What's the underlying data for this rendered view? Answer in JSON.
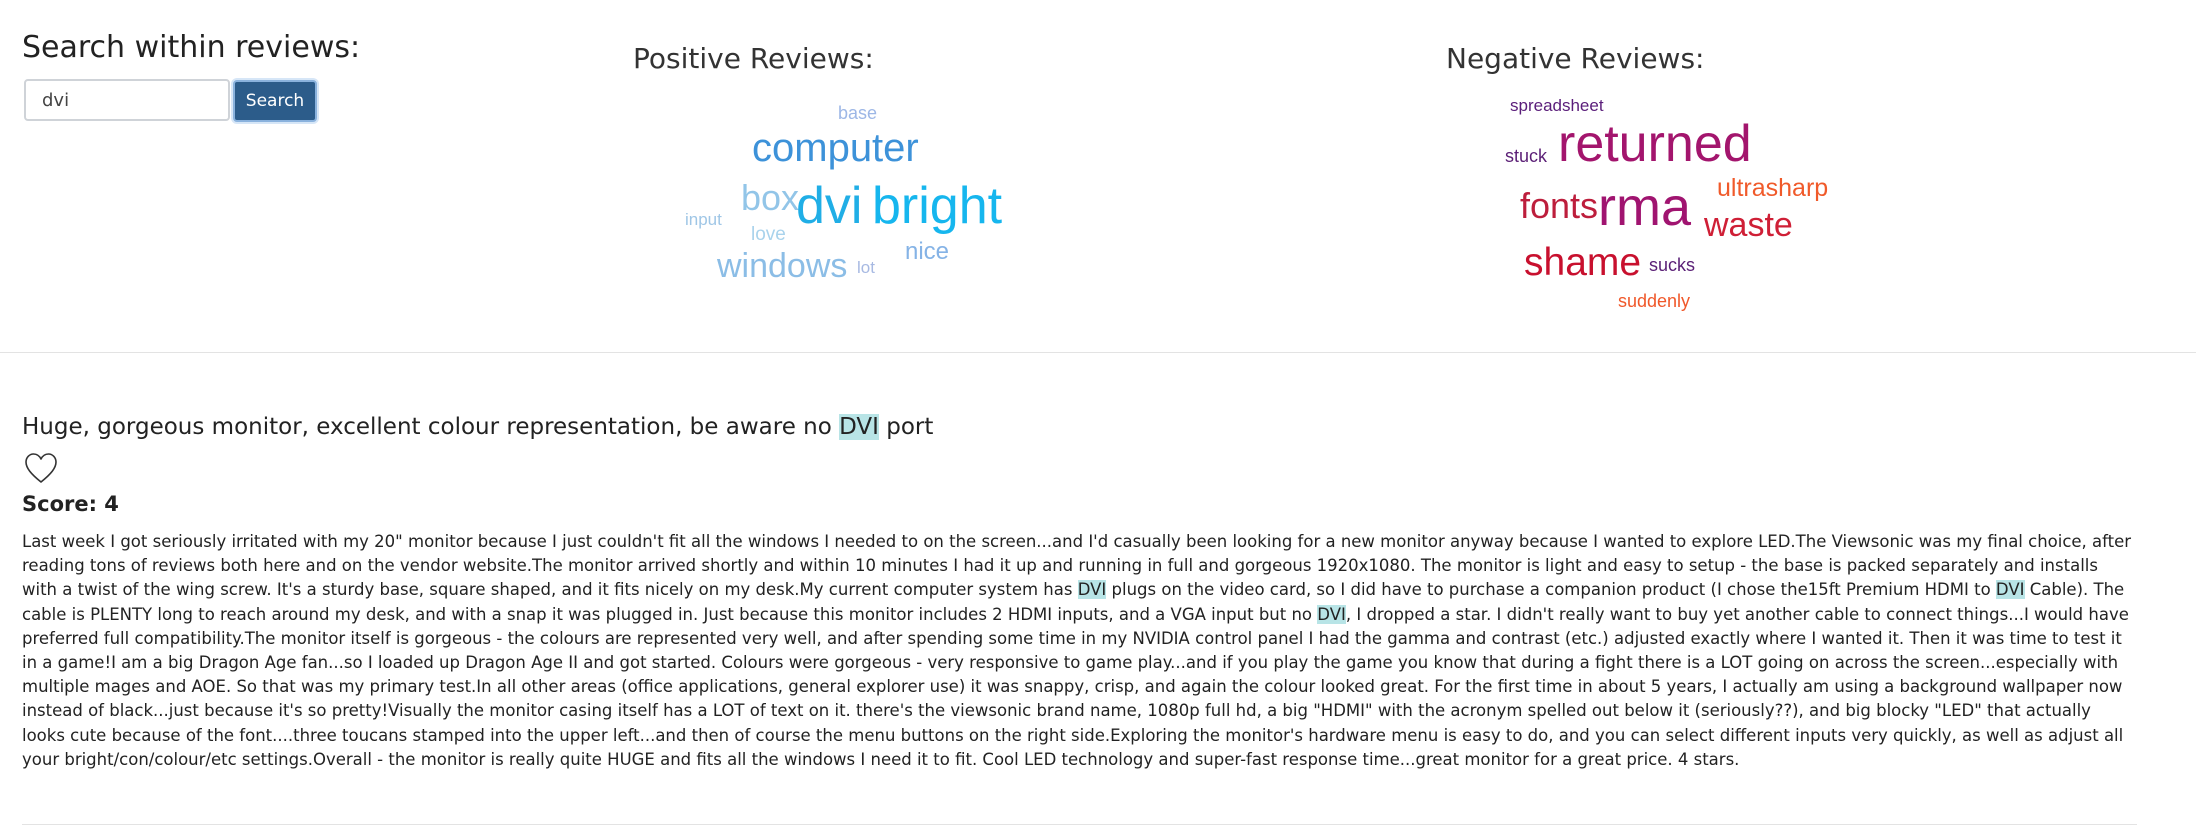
{
  "search": {
    "heading": "Search within reviews:",
    "input_value": "dvi",
    "button_label": "Search"
  },
  "positive": {
    "title": "Positive Reviews:",
    "words": [
      {
        "text": "base",
        "color": "#9db7e6"
      },
      {
        "text": "computer",
        "color": "#3d92d9"
      },
      {
        "text": "box",
        "color": "#92c5e8"
      },
      {
        "text": "dvi",
        "color": "#20aee6"
      },
      {
        "text": "bright",
        "color": "#16b6ee"
      },
      {
        "text": "input",
        "color": "#9fc6e6"
      },
      {
        "text": "love",
        "color": "#a9d3ec"
      },
      {
        "text": "nice",
        "color": "#85b3e6"
      },
      {
        "text": "windows",
        "color": "#8bbde6"
      },
      {
        "text": "lot",
        "color": "#a7b9e2"
      }
    ]
  },
  "negative": {
    "title": "Negative Reviews:",
    "words": [
      {
        "text": "spreadsheet",
        "color": "#5a1d7a"
      },
      {
        "text": "stuck",
        "color": "#5b1f76"
      },
      {
        "text": "returned",
        "color": "#a3156d"
      },
      {
        "text": "fonts",
        "color": "#bd1e3c"
      },
      {
        "text": "rma",
        "color": "#a01470"
      },
      {
        "text": "ultrasharp",
        "color": "#f05a2a"
      },
      {
        "text": "waste",
        "color": "#cf1f36"
      },
      {
        "text": "shame",
        "color": "#c8102e"
      },
      {
        "text": "sucks",
        "color": "#5a1f76"
      },
      {
        "text": "suddenly",
        "color": "#f0582a"
      }
    ]
  },
  "review": {
    "title_parts": [
      "Huge, gorgeous monitor, excellent colour representation, be aware no ",
      "DVI",
      " port"
    ],
    "heart_icon": "heart-outline-icon",
    "score": "Score: 4",
    "body_parts": [
      "Last week I got seriously irritated with my 20\" monitor because I just couldn't fit all the windows I needed to on the screen...and I'd casually been looking for a new monitor anyway because I wanted to explore LED.The Viewsonic was my final choice, after reading tons of reviews both here and on the vendor website.The monitor arrived shortly and within 10 minutes I had it up and running in full and gorgeous 1920x1080. The monitor is light and easy to setup - the base is packed separately and installs with a twist of the wing screw. It's a sturdy base, square shaped, and it fits nicely on my desk.My current computer system has ",
      "DVI",
      " plugs on the video card, so I did have to purchase a companion product (I chose the15ft Premium HDMI to ",
      "DVI",
      " Cable). The cable is PLENTY long to reach around my desk, and with a snap it was plugged in. Just because this monitor includes 2 HDMI inputs, and a VGA input but no ",
      "DVI",
      ", I dropped a star. I didn't really want to buy yet another cable to connect things...I would have preferred full compatibility.The monitor itself is gorgeous - the colours are represented very well, and after spending some time in my NVIDIA control panel I had the gamma and contrast (etc.) adjusted exactly where I wanted it. Then it was time to test it in a game!I am a big Dragon Age fan...so I loaded up Dragon Age II and got started. Colours were gorgeous - very responsive to game play...and if you play the game you know that during a fight there is a LOT going on across the screen...especially with multiple mages and AOE. So that was my primary test.In all other areas (office applications, general explorer use) it was snappy, crisp, and again the colour looked great. For the first time in about 5 years, I actually am using a background wallpaper now instead of black...just because it's so pretty!Visually the monitor casing itself has a LOT of text on it. there's the viewsonic brand name, 1080p full hd, a big \"HDMI\" with the acronym spelled out below it (seriously??), and big blocky \"LED\" that actually looks cute because of the font....three toucans stamped into the upper left...and then of course the menu buttons on the right side.Exploring the monitor's hardware menu is easy to do, and you can select different inputs very quickly, as well as adjust all your bright/con/colour/etc settings.Overall - the monitor is really quite HUGE and fits all the windows I need it to fit. Cool LED technology and super-fast response time...great monitor for a great price. 4 stars."
    ]
  }
}
